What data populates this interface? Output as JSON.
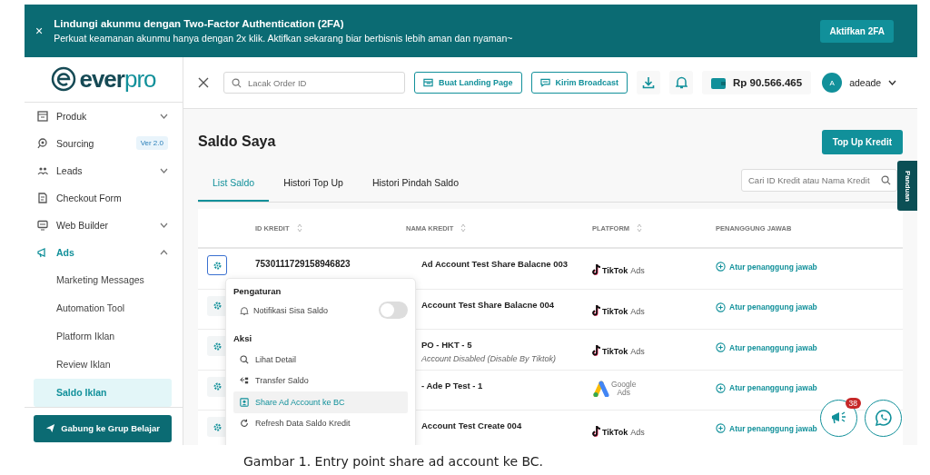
{
  "banner": {
    "close": "×",
    "title": "Lindungi akunmu dengan Two-Factor Authentication (2FA)",
    "text": "Perkuat keamanan akunmu hanya dengan 2x klik. Aktifkan sekarang biar berbisnis lebih aman dan nyaman~",
    "button": "Aktifkan 2FA"
  },
  "header": {
    "search_placeholder": "Lacak Order ID",
    "buttons": [
      "Buat Landing Page",
      "Kirim Broadcast"
    ],
    "balance": "Rp 90.566.465",
    "avatar": "A",
    "user": "adeade"
  },
  "sidebar": {
    "logo": {
      "main": "ever",
      "accent": "pro"
    },
    "items": [
      {
        "label": "Produk",
        "kind": "box",
        "expanded": false,
        "selected": false
      },
      {
        "label": "Sourcing",
        "kind": "search",
        "badge": "Ver 2.0",
        "selected": false
      },
      {
        "label": "Leads",
        "kind": "people",
        "expanded": false,
        "selected": false
      },
      {
        "label": "Checkout Form",
        "kind": "form",
        "selected": false
      },
      {
        "label": "Web Builder",
        "kind": "monitor",
        "expanded": false,
        "selected": false
      },
      {
        "label": "Ads",
        "kind": "megaphone",
        "expanded": true,
        "selected": true,
        "children": [
          {
            "label": "Marketing Messages",
            "selected": false
          },
          {
            "label": "Automation Tool",
            "selected": false
          },
          {
            "label": "Platform Iklan",
            "selected": false
          },
          {
            "label": "Review Iklan",
            "selected": false
          },
          {
            "label": "Saldo Iklan",
            "selected": true
          }
        ]
      }
    ],
    "join_button": "Gabung ke Grup Belajar"
  },
  "page": {
    "title": "Saldo Saya",
    "top_up_button": "Top Up Kredit",
    "guide_tab": "Panduan",
    "tabs": [
      {
        "label": "List Saldo",
        "selected": true
      },
      {
        "label": "Histori Top Up",
        "selected": false
      },
      {
        "label": "Histori Pindah Saldo",
        "selected": false
      }
    ],
    "search_placeholder": "Cari ID Kredit atau Nama Kredit"
  },
  "table": {
    "columns": [
      "ID KREDIT",
      "NAMA KREDIT",
      "PLATFORM",
      "PENANGGUNG JAWAB"
    ],
    "rows": [
      {
        "id": "7530111729158946823",
        "name": "Ad Account Test Share Balacne 003",
        "platform": {
          "kind": "tiktok",
          "name": "TikTok",
          "suffix": "Ads"
        },
        "owner": "Atur penanggung jawab",
        "selected": true
      },
      {
        "name": "Account Test Share Balacne 004",
        "platform": {
          "kind": "tiktok",
          "name": "TikTok",
          "suffix": "Ads"
        },
        "owner": "Atur penanggung jawab",
        "selected": false
      },
      {
        "name": "PO - HKT - 5",
        "note": "Account Disabled (Disable By Tiktok)",
        "platform": {
          "kind": "tiktok",
          "name": "TikTok",
          "suffix": "Ads"
        },
        "owner": "Atur penanggung jawab",
        "selected": false
      },
      {
        "name": "- Ade P Test - 1",
        "platform": {
          "kind": "google",
          "name": "Google",
          "suffix": "Ads"
        },
        "owner": "Atur penanggung jawab",
        "selected": false
      },
      {
        "name": "Account Test Create 004",
        "platform": {
          "kind": "tiktok",
          "name": "TikTok",
          "suffix": "Ads"
        },
        "owner": "Atur penanggung jawab",
        "selected": false
      }
    ]
  },
  "menu": {
    "settings_title": "Pengaturan",
    "toggle": {
      "label": "Notifikasi Sisa Saldo",
      "on": false
    },
    "actions_title": "Aksi",
    "items": [
      {
        "label": "Lihat Detail",
        "kind": "search",
        "selected": false
      },
      {
        "label": "Transfer Saldo",
        "kind": "transfer",
        "selected": false
      },
      {
        "label": "Share Ad Account ke BC",
        "kind": "share",
        "selected": true
      },
      {
        "label": "Refresh Data Saldo Kredit",
        "kind": "refresh",
        "selected": false
      }
    ]
  },
  "floating": {
    "badge": "38"
  },
  "caption": "Gambar 1. Entry point share ad account ke BC."
}
